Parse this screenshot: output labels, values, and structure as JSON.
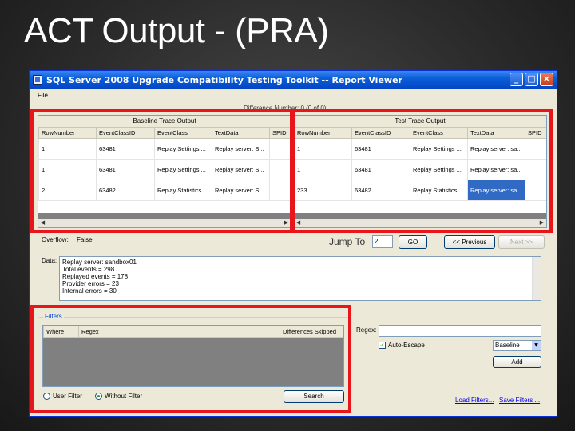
{
  "slide": {
    "title": "ACT Output - (PRA)"
  },
  "window": {
    "title": "SQL Server 2008 Upgrade Compatibility Testing Toolkit -- Report Viewer",
    "menu": [
      "File"
    ],
    "ghost_text": "Difference Number: 0 (0 of 0)"
  },
  "baseline": {
    "header": "Baseline Trace Output",
    "columns": [
      "RowNumber",
      "EventClassID",
      "EventClass",
      "TextData",
      "SPID"
    ],
    "rows": [
      [
        "1",
        "63481",
        "Replay Settings ...",
        "Replay server: S...",
        ""
      ],
      [
        "1",
        "63481",
        "Replay Settings ...",
        "Replay server: S...",
        ""
      ],
      [
        "2",
        "63482",
        "Replay Statistics ...",
        "Replay server: S...",
        ""
      ]
    ]
  },
  "test": {
    "header": "Test Trace Output",
    "columns": [
      "RowNumber",
      "EventClassID",
      "EventClass",
      "TextData",
      "SPID"
    ],
    "rows": [
      [
        "1",
        "63481",
        "Replay Settings ...",
        "Replay server: sa...",
        ""
      ],
      [
        "1",
        "63481",
        "Replay Settings ...",
        "Replay server: sa...",
        ""
      ],
      [
        "233",
        "63482",
        "Replay Statistics ...",
        "Replay server: sa...",
        ""
      ]
    ]
  },
  "overflow": {
    "label": "Overflow:",
    "value": "False"
  },
  "jump": {
    "label": "Jump To",
    "value": "2",
    "go": "GO",
    "previous": "<< Previous",
    "next": "Next >>"
  },
  "data_field": {
    "label": "Data:",
    "lines": [
      "Replay server: sandbox01",
      "Total events = 298",
      "Replayed events = 178",
      "Provider errors = 23",
      "Internal errors = 30"
    ]
  },
  "filters": {
    "title": "Filters",
    "columns": [
      "Where",
      "Regex",
      "Differences Skipped"
    ],
    "user_filter": "User Filter",
    "without_filter": "Without Filter",
    "search": "Search"
  },
  "regex": {
    "label": "Regex:",
    "value": "",
    "auto_escape": "Auto-Escape",
    "target": "Baseline",
    "add": "Add"
  },
  "links": {
    "load": "Load Filters...",
    "save": "Save Filters ..."
  },
  "colors": {
    "highlight": "#e8151b",
    "selection": "#316ac5",
    "titlebar": "#0a5fd8"
  }
}
